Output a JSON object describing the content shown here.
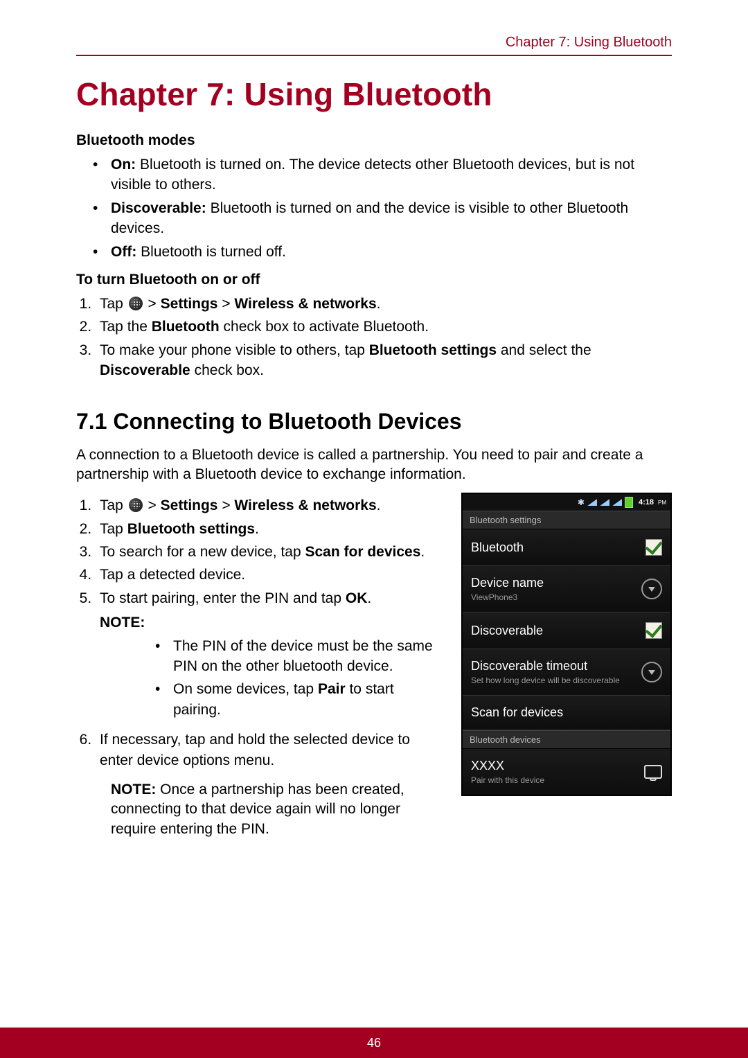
{
  "header": {
    "breadcrumb": "Chapter 7: Using Bluetooth"
  },
  "h1": "Chapter 7: Using Bluetooth",
  "bluetooth_modes": {
    "heading": "Bluetooth modes",
    "items": [
      {
        "label": "On:",
        "text": " Bluetooth is turned on. The device detects other Bluetooth devices, but is not visible to others."
      },
      {
        "label": "Discoverable:",
        "text": " Bluetooth is turned on and the device is visible to other Bluetooth devices."
      },
      {
        "label": "Off:",
        "text": " Bluetooth is turned off."
      }
    ]
  },
  "turn_on_off": {
    "heading": "To turn Bluetooth on or off",
    "step1_pre": "Tap ",
    "step1_post": "  > ",
    "step1_settings": "Settings",
    "step1_gt": " > ",
    "step1_wn": "Wireless & networks",
    "step1_end": ".",
    "step2_pre": "Tap the ",
    "step2_b": "Bluetooth",
    "step2_post": " check box to activate Bluetooth.",
    "step3_pre": "To make your phone visible to others, tap ",
    "step3_b1": "Bluetooth settings",
    "step3_mid": " and select the ",
    "step3_b2": "Discoverable",
    "step3_post": " check box."
  },
  "h2": "7.1 Connecting to Bluetooth Devices",
  "intro": "A connection to a Bluetooth device is called a partnership. You need to pair and create a partnership with a Bluetooth device to exchange information.",
  "connect": {
    "s1_pre": "Tap ",
    "s1_post": "  > ",
    "s1_settings": "Settings",
    "s1_gt": " > ",
    "s1_wn": "Wireless & networks",
    "s1_end": ".",
    "s2_pre": "Tap ",
    "s2_b": "Bluetooth settings",
    "s2_end": ".",
    "s3_pre": "To search for a new device, tap ",
    "s3_b": "Scan for devices",
    "s3_end": ".",
    "s4": "Tap a detected device.",
    "s5_pre": "To start pairing, enter the PIN and tap ",
    "s5_b": "OK",
    "s5_end": ".",
    "note_label": "NOTE:",
    "note1": "The PIN of the device must be the same PIN on the other bluetooth device.",
    "note2_pre": "On some devices, tap ",
    "note2_b": "Pair",
    "note2_post": " to start pairing.",
    "s6": "If necessary, tap and hold the selected device to enter device options menu.",
    "final_note_label": "NOTE:",
    "final_note": " Once a partnership has been created, connecting to that device again will no longer require entering the PIN."
  },
  "phone": {
    "time": "4:18",
    "pm": "PM",
    "title": "Bluetooth settings",
    "rows": {
      "bluetooth": "Bluetooth",
      "device_name": "Device name",
      "device_name_sub": "ViewPhone3",
      "discoverable": "Discoverable",
      "disc_timeout": "Discoverable timeout",
      "disc_timeout_sub": "Set how long device will be discoverable",
      "scan": "Scan for devices"
    },
    "devices_title": "Bluetooth devices",
    "device_item": "XXXX",
    "device_item_sub": "Pair with this device"
  },
  "page_number": "46"
}
